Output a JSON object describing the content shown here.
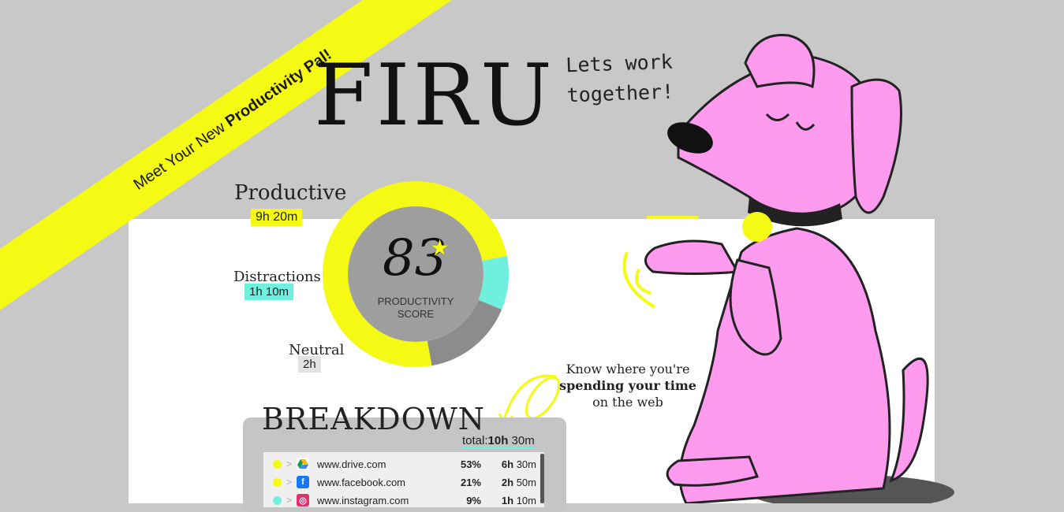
{
  "banner": {
    "prefix": "Meet Your New ",
    "bold": "Productivity Pal!"
  },
  "logo": "FIRU",
  "speech": {
    "line1": "Lets work",
    "line2": "together!"
  },
  "productive": {
    "title": "Productive",
    "time": "9h 20m"
  },
  "distractions": {
    "title": "Distractions",
    "time": "1h 10m"
  },
  "neutral": {
    "title": "Neutral",
    "time": "2h"
  },
  "score": {
    "value": "83",
    "label_line1": "PRODUCTIVITY",
    "label_line2": "SCORE"
  },
  "know": {
    "line1": "Know where you're",
    "line2": "spending your time",
    "line3": "on the web"
  },
  "breakdown": {
    "title": "BREAKDOWN",
    "total_label": "total:",
    "total_hours": "10h",
    "total_minutes": " 30m",
    "rows": [
      {
        "dot_color": "#f5fa14",
        "icon": "google-drive-icon",
        "url": "www.drive.com",
        "pct": "53%",
        "hours": "6h",
        "minutes": " 30m"
      },
      {
        "dot_color": "#f5fa14",
        "icon": "facebook-icon",
        "url": "www.facebook.com",
        "pct": "21%",
        "hours": "2h",
        "minutes": " 50m"
      },
      {
        "dot_color": "#6ff0df",
        "icon": "instagram-icon",
        "url": "www.instagram.com",
        "pct": "9%",
        "hours": "1h",
        "minutes": " 10m"
      }
    ]
  },
  "colors": {
    "yellow": "#f5fa14",
    "cyan": "#6ff0df",
    "pink": "#fe9bef",
    "grey_bg": "#c8c8c8"
  },
  "chart_data": {
    "type": "pie",
    "categories": [
      "Productive",
      "Distractions",
      "Neutral"
    ],
    "values": [
      9.33,
      1.17,
      2
    ]
  }
}
